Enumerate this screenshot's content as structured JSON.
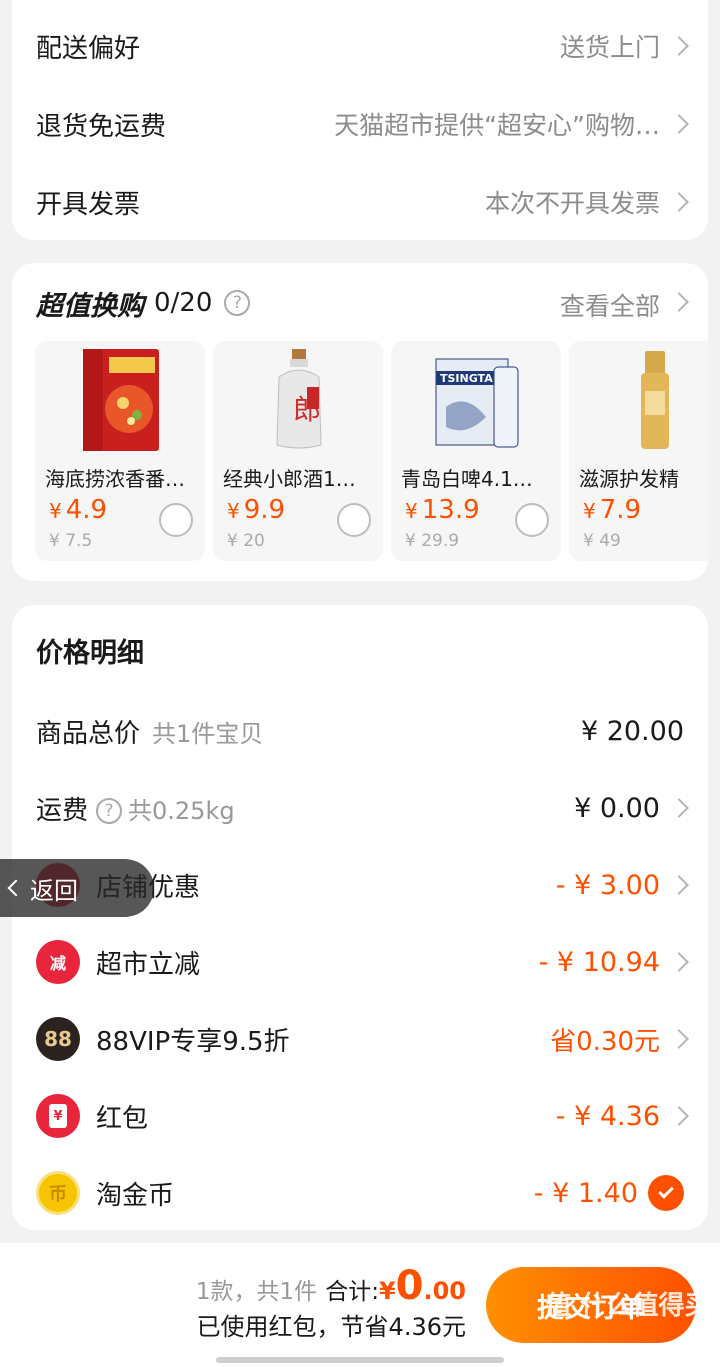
{
  "delivery": {
    "rows": [
      {
        "label": "配送偏好",
        "value": "送货上门"
      },
      {
        "label": "退货免运费",
        "value": "天猫超市提供“超安心”购物…"
      },
      {
        "label": "开具发票",
        "value": "本次不开具发票"
      }
    ]
  },
  "exchange": {
    "title": "超值换购",
    "count": "0/20",
    "help": "?",
    "view_all": "查看全部",
    "products": [
      {
        "name": "海底捞浓香番…",
        "price": "4.9",
        "currency": "¥",
        "orig": "¥ 7.5"
      },
      {
        "name": "经典小郎酒1…",
        "price": "9.9",
        "currency": "¥",
        "orig": "¥ 20"
      },
      {
        "name": "青岛白啤4.1…",
        "price": "13.9",
        "currency": "¥",
        "orig": "¥ 29.9"
      },
      {
        "name": "滋源护发精",
        "price": "7.9",
        "currency": "¥",
        "orig": "¥ 49"
      }
    ]
  },
  "price": {
    "title": "价格明细",
    "total": {
      "label": "商品总价",
      "sub": "共1件宝贝",
      "value": "¥ 20.00"
    },
    "shipping": {
      "label": "运费",
      "sub": "共0.25kg",
      "value": "¥ 0.00"
    },
    "discounts": [
      {
        "label": "店铺优惠",
        "value": "- ¥ 3.00",
        "icon": "shop-coupon-icon",
        "icon_text": "",
        "color": "#e8253a"
      },
      {
        "label": "超市立减",
        "value": "- ¥ 10.94",
        "icon": "reduce-icon",
        "icon_text": "减",
        "color": "#e8253a"
      },
      {
        "label": "88VIP专享9.5折",
        "value": "省0.30元",
        "icon": "vip88-icon",
        "icon_text": "88",
        "color": "#2b2320"
      },
      {
        "label": "红包",
        "value": "- ¥ 4.36",
        "icon": "red-packet-icon",
        "icon_text": "¥",
        "color": "#e8253a"
      },
      {
        "label": "淘金币",
        "value": "- ¥ 1.40",
        "icon": "gold-coin-icon",
        "icon_text": "币",
        "color": "#f6c500"
      }
    ]
  },
  "back_button": "返回",
  "footer": {
    "count": "1款，共1件",
    "total_label": "合计:",
    "total_currency": "¥",
    "total_int": "0",
    "total_dec": ".00",
    "savings": "已使用红包，节省4.36元",
    "submit": "提交订单",
    "watermark": "值 什么值得买"
  },
  "colors": {
    "accent": "#ff5000",
    "brand_red": "#e8253a"
  }
}
